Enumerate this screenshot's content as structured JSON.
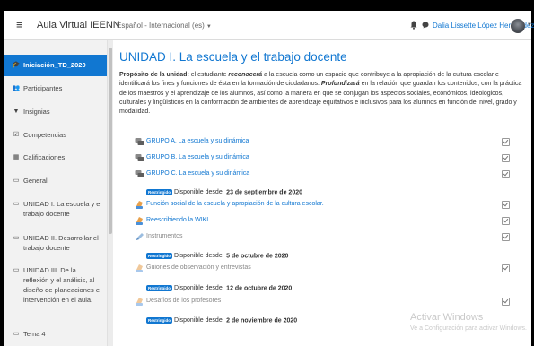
{
  "header": {
    "site_name": "Aula Virtual IEENN",
    "language": "Español - Internacional (es)",
    "user_name": "Dalia Lissette López Hernández"
  },
  "drawer": {
    "items": [
      {
        "label": "Iniciación_TD_2020",
        "icon": "graduation-cap-icon",
        "active": true
      },
      {
        "label": "Participantes",
        "icon": "users-icon"
      },
      {
        "label": "Insignias",
        "icon": "badge-icon"
      },
      {
        "label": "Competencias",
        "icon": "checkbox-icon"
      },
      {
        "label": "Calificaciones",
        "icon": "table-icon"
      },
      {
        "label": "General",
        "icon": "folder-icon"
      },
      {
        "label": "UNIDAD I. La escuela y el trabajo docente",
        "icon": "folder-icon"
      },
      {
        "label": "UNIDAD II. Desarrollar el trabajo docente",
        "icon": "folder-icon"
      },
      {
        "label": "UNIDAD III. De la reflexión y el análisis, al diseño de planeaciones e intervención en el aula.",
        "icon": "folder-icon"
      },
      {
        "label": "Tema 4",
        "icon": "folder-icon"
      }
    ]
  },
  "section": {
    "title": "UNIDAD I. La escuela y el trabajo docente",
    "summary_lead": "Propósito de la unidad:",
    "summary_part1": " el estudiante ",
    "summary_em1": "reconocerá",
    "summary_part2": " a la escuela como un espacio que contribuye a la apropiación de la cultura escolar e identificará los fines y funciones de ésta en la formación de ciudadanos. ",
    "summary_em2": "Profundizará",
    "summary_part3": " en la relación que guardan los contenidos, con la práctica de los maestros y el aprendizaje de los alumnos, así como la manera en que se conjugan los aspectos sociales, económicos, ideológicos, culturales y lingüísticos en la conformación de ambientes de aprendizaje equitativos e inclusivos para los alumnos en función del nivel, grado y modalidad."
  },
  "activities": [
    {
      "label": "GRUPO A. La escuela y su dinámica",
      "icon": "forum-icon",
      "check": true
    },
    {
      "label": "GRUPO B. La escuela y su dinámica",
      "icon": "forum-icon",
      "check": true
    },
    {
      "label": "GRUPO C. La escuela y su dinámica",
      "icon": "forum-icon",
      "check": true
    },
    {
      "label": "Función social de la escuela y apropiación de la cultura escolar.",
      "icon": "assignment-icon",
      "check": true
    },
    {
      "label": "Reescribiendo la WIKI",
      "icon": "wiki-icon",
      "check": true
    },
    {
      "label": "Instrumentos",
      "icon": "pen-icon",
      "check": true
    },
    {
      "label": "Guiones de observación y entrevistas",
      "icon": "assignment-icon",
      "check": true
    },
    {
      "label": "Desafíos de los profesores",
      "icon": "assignment-icon",
      "check": true
    }
  ],
  "restrictions": {
    "badge": "Restringido",
    "text": "Disponible desde",
    "dates": [
      "23 de septiembre de 2020",
      "5 de octubre de 2020",
      "12 de octubre de 2020",
      "2 de noviembre de 2020"
    ]
  },
  "watermark": {
    "title": "Activar Windows",
    "subtitle": "Ve a Configuración para activar Windows."
  },
  "colors": {
    "accent": "#1177d1",
    "drawer_bg": "#f2f2f2"
  }
}
